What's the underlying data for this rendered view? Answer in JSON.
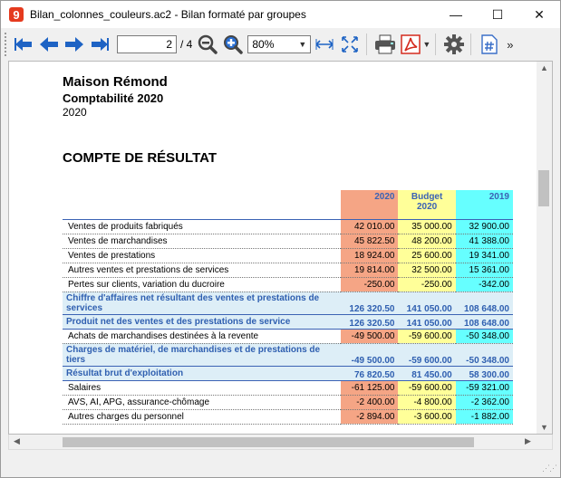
{
  "window": {
    "title": "Bilan_colonnes_couleurs.ac2 - Bilan formaté par groupes",
    "app_icon_glyph": "9",
    "minimize": "—",
    "maximize": "☐",
    "close": "✕"
  },
  "toolbar": {
    "page_value": "2",
    "page_total": "/ 4",
    "zoom_value": "80%",
    "overflow": "»"
  },
  "report": {
    "company": "Maison Rémond",
    "subtitle": "Comptabilité 2020",
    "year": "2020",
    "section_title": "COMPTE DE RÉSULTAT",
    "columns": {
      "col_a": "2020",
      "col_b": "Budget 2020",
      "col_c": "2019"
    },
    "rows": [
      {
        "kind": "detail",
        "label": "Ventes de produits fabriqués",
        "a": "42 010.00",
        "b": "35 000.00",
        "c": "32 900.00"
      },
      {
        "kind": "detail",
        "label": "Ventes de marchandises",
        "a": "45 822.50",
        "b": "48 200.00",
        "c": "41 388.00"
      },
      {
        "kind": "detail",
        "label": "Ventes de prestations",
        "a": "18 924.00",
        "b": "25 600.00",
        "c": "19 341.00"
      },
      {
        "kind": "detail",
        "label": "Autres ventes et prestations de services",
        "a": "19 814.00",
        "b": "32 500.00",
        "c": "15 361.00"
      },
      {
        "kind": "detail",
        "label": "Pertes sur clients, variation du ducroire",
        "a": "-250.00",
        "b": "-250.00",
        "c": "-342.00"
      },
      {
        "kind": "total",
        "label": "Chiffre d'affaires net résultant des ventes et prestations de services",
        "a": "126 320.50",
        "b": "141 050.00",
        "c": "108 648.00"
      },
      {
        "kind": "total",
        "label": "Produit net des ventes et des prestations de service",
        "a": "126 320.50",
        "b": "141 050.00",
        "c": "108 648.00"
      },
      {
        "kind": "detail",
        "label": "Achats de marchandises destinées à la revente",
        "a": "-49 500.00",
        "b": "-59 600.00",
        "c": "-50 348.00"
      },
      {
        "kind": "total",
        "label": "Charges de matériel, de marchandises et de prestations de tiers",
        "a": "-49 500.00",
        "b": "-59 600.00",
        "c": "-50 348.00"
      },
      {
        "kind": "total",
        "label": "Résultat brut d'exploitation",
        "a": "76 820.50",
        "b": "81 450.00",
        "c": "58 300.00"
      },
      {
        "kind": "detail",
        "label": "Salaires",
        "a": "-61 125.00",
        "b": "-59 600.00",
        "c": "-59 321.00"
      },
      {
        "kind": "detail",
        "label": "AVS, AI, APG, assurance-chômage",
        "a": "-2 400.00",
        "b": "-4 800.00",
        "c": "-2 362.00"
      },
      {
        "kind": "detail",
        "label": "Autres charges du personnel",
        "a": "-2 894.00",
        "b": "-3 600.00",
        "c": "-1 882.00"
      }
    ]
  },
  "colors": {
    "col_a": "#f5a585",
    "col_b": "#ffff99",
    "col_c": "#66ffff",
    "total_row_bg": "#ddeef7",
    "accent_text": "#2f5fb0"
  }
}
